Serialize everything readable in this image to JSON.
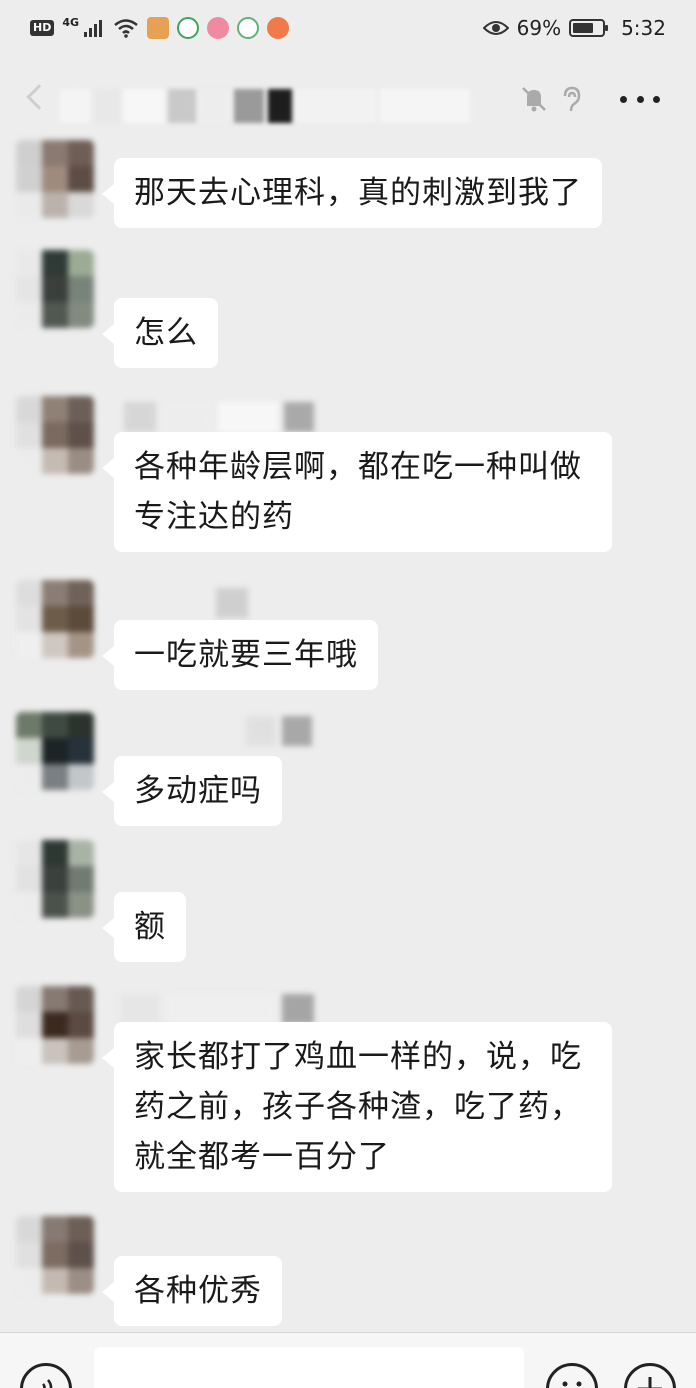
{
  "status_bar": {
    "hd": "HD",
    "network": "4G",
    "battery_percent": "69%",
    "time": "5:32",
    "icons": [
      "signal-icon",
      "wifi-icon",
      "eye-icon",
      "battery-icon"
    ]
  },
  "header": {
    "icons": [
      "back-icon",
      "mute-icon",
      "ear-icon",
      "more-icon"
    ]
  },
  "messages": [
    {
      "text": "那天去心理科，真的刺激到我了"
    },
    {
      "text": "怎么"
    },
    {
      "text": "各种年龄层啊，都在吃一种叫做专注达的药"
    },
    {
      "text": "一吃就要三年哦"
    },
    {
      "text": "多动症吗"
    },
    {
      "text": "额"
    },
    {
      "text": "家长都打了鸡血一样的，说，吃药之前，孩子各种渣，吃了药，就全都考一百分了"
    },
    {
      "text": "各种优秀"
    }
  ],
  "input_bar": {
    "icons": [
      "voice-icon",
      "emoji-icon",
      "plus-icon"
    ]
  },
  "colors": {
    "background": "#ededed",
    "bubble": "#ffffff",
    "text": "#1a1a1a"
  }
}
